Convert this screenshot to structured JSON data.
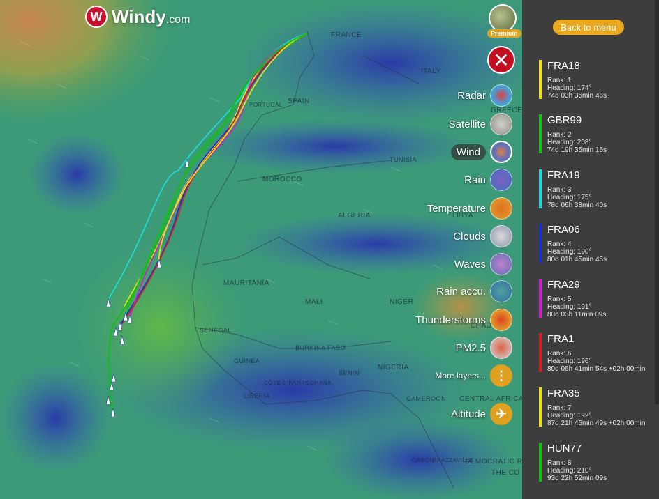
{
  "app": {
    "logo_text": "Windy",
    "logo_suffix": ".com",
    "premium_badge": "Premium"
  },
  "map": {
    "countries": [
      "FRANCE",
      "SPAIN",
      "PORTUGAL",
      "ITALY",
      "GREECE",
      "TUNISIA",
      "MOROCCO",
      "ALGERIA",
      "LIBYA",
      "MAURITANIA",
      "MALI",
      "NIGER",
      "CHAD",
      "SENEGAL",
      "GUINEA",
      "BURKINA FASO",
      "CÔTE D'IVOIRE",
      "GHANA",
      "BENIN",
      "NIGERIA",
      "LIBERIA",
      "CAMEROON",
      "CENTRAL AFRICA",
      "GABON",
      "BRAZZAVILLE",
      "DEMOCRATIC R",
      "THE CO"
    ],
    "route_colors": [
      "#f0e020",
      "#18c018",
      "#20d8d8",
      "#1830d0",
      "#d020d0",
      "#d02020",
      "#e8e010",
      "#10c010"
    ]
  },
  "layers": [
    {
      "label": "Radar",
      "icon": "radar-icon",
      "active": false
    },
    {
      "label": "Satellite",
      "icon": "satellite-icon",
      "active": false
    },
    {
      "label": "Wind",
      "icon": "wind-icon",
      "active": true
    },
    {
      "label": "Rain",
      "icon": "rain-icon",
      "active": false
    },
    {
      "label": "Temperature",
      "icon": "temperature-icon",
      "active": false
    },
    {
      "label": "Clouds",
      "icon": "clouds-icon",
      "active": false
    },
    {
      "label": "Waves",
      "icon": "waves-icon",
      "active": false
    },
    {
      "label": "Rain accu.",
      "icon": "rain-accumulation-icon",
      "active": false
    },
    {
      "label": "Thunderstorms",
      "icon": "thunderstorms-icon",
      "active": false
    },
    {
      "label": "PM2.5",
      "icon": "pm25-icon",
      "active": false
    },
    {
      "label": "More layers...",
      "icon": "more-layers-icon",
      "active": false
    },
    {
      "label": "Altitude",
      "icon": "airplane-icon",
      "active": false
    }
  ],
  "sidebar": {
    "back_label": "Back to menu",
    "entries": [
      {
        "name": "FRA18",
        "color": "#f0e020",
        "rank": "Rank: 1",
        "heading": "Heading: 174°",
        "time": "74d 03h 35min 46s"
      },
      {
        "name": "GBR99",
        "color": "#18c018",
        "rank": "Rank: 2",
        "heading": "Heading: 208°",
        "time": "74d 19h 35min 15s"
      },
      {
        "name": "FRA19",
        "color": "#20d8d8",
        "rank": "Rank: 3",
        "heading": "Heading: 175°",
        "time": "78d 06h 38min 40s"
      },
      {
        "name": "FRA06",
        "color": "#1830d0",
        "rank": "Rank: 4",
        "heading": "Heading: 190°",
        "time": "80d 01h 45min 45s"
      },
      {
        "name": "FRA29",
        "color": "#d020d0",
        "rank": "Rank: 5",
        "heading": "Heading: 191°",
        "time": "80d 03h 11min 09s"
      },
      {
        "name": "FRA1",
        "color": "#d02020",
        "rank": "Rank: 6",
        "heading": "Heading: 196°",
        "time": "80d 06h 41min 54s +02h 00min"
      },
      {
        "name": "FRA35",
        "color": "#e8e010",
        "rank": "Rank: 7",
        "heading": "Heading: 192°",
        "time": "87d 21h 45min 49s +02h 00min"
      },
      {
        "name": "HUN77",
        "color": "#10c010",
        "rank": "Rank: 8",
        "heading": "Heading: 210°",
        "time": "93d 22h 52min 09s"
      }
    ]
  }
}
